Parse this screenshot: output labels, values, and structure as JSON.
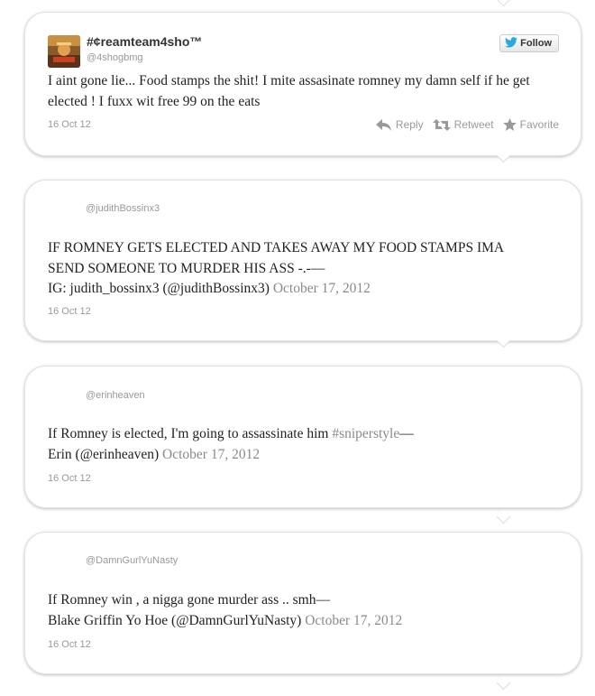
{
  "tweets": [
    {
      "author": {
        "display_name": "#¢reamteam4sho™",
        "handle": "@4shogbmg"
      },
      "follow_label": "Follow",
      "text": "I aint gone lie... Food stamps the shit! I mite assasinate romney my damn self if he get elected ! I fuxx wit free 99 on the eats",
      "date": "16 Oct 12",
      "actions": {
        "reply": "Reply",
        "retweet": "Retweet",
        "favorite": "Favorite"
      }
    },
    {
      "handle": "@judithBossinx3",
      "text_lines": [
        "IF ROMNEY GETS ELECTED AND TAKES AWAY MY FOOD STAMPS IMA",
        "SEND SOMEONE TO MURDER HIS ASS -.-—"
      ],
      "attribution": "IG: judith_bossinx3 (@judithBossinx3)",
      "attribution_date": "October 17, 2012",
      "date": "16 Oct 12"
    },
    {
      "handle": "@erinheaven",
      "text_main": "If Romney is elected, I'm going to assassinate him",
      "hashtag": "#sniperstyle",
      "text_dash": "—",
      "attribution": "Erin (@erinheaven)",
      "attribution_date": "October 17, 2012",
      "date": "16 Oct 12"
    },
    {
      "handle": "@DamnGurlYuNasty",
      "text_main": "If Romney win , a nigga gone murder ass .. smh—",
      "attribution": "Blake Griffin Yo Hoe (@DamnGurlYuNasty)",
      "attribution_date": "October 17, 2012",
      "date": "16 Oct 12"
    }
  ],
  "colors": {
    "text": "#222222",
    "muted": "#999999",
    "link_faint": "#8a8a8a",
    "twitter_blue": "#2aa9e0"
  },
  "icons": [
    "twitter-bird-icon",
    "reply-icon",
    "retweet-icon",
    "favorite-star-icon"
  ]
}
